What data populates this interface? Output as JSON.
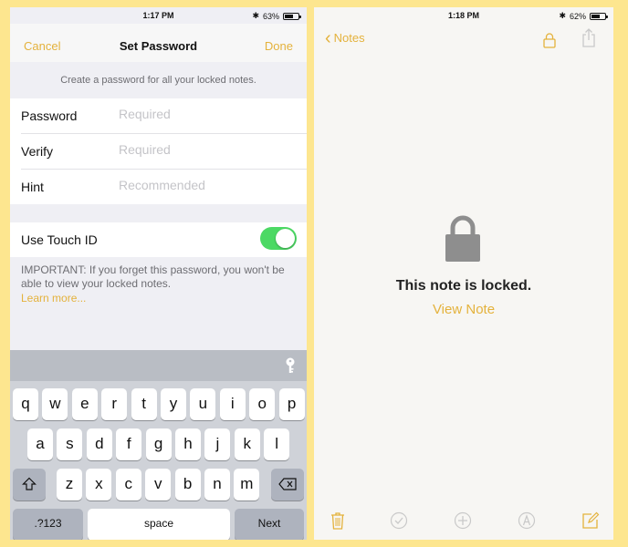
{
  "colors": {
    "accent": "#e4b23c",
    "toggle_on": "#4cd964",
    "background": "#fde68f"
  },
  "left_phone": {
    "status": {
      "time": "1:17 PM",
      "battery": "63%",
      "battery_fraction": 0.63
    },
    "nav": {
      "cancel": "Cancel",
      "title": "Set Password",
      "done": "Done"
    },
    "header_text": "Create a password for all your locked notes.",
    "fields": [
      {
        "label": "Password",
        "placeholder": "Required"
      },
      {
        "label": "Verify",
        "placeholder": "Required"
      },
      {
        "label": "Hint",
        "placeholder": "Recommended"
      }
    ],
    "touch_id": {
      "label": "Use Touch ID",
      "enabled": true
    },
    "important": "IMPORTANT: If you forget this password, you won't be able to view your locked notes.",
    "learn_more": "Learn more...",
    "keyboard": {
      "row1": [
        "q",
        "w",
        "e",
        "r",
        "t",
        "y",
        "u",
        "i",
        "o",
        "p"
      ],
      "row2": [
        "a",
        "s",
        "d",
        "f",
        "g",
        "h",
        "j",
        "k",
        "l"
      ],
      "row3": [
        "z",
        "x",
        "c",
        "v",
        "b",
        "n",
        "m"
      ],
      "numbers": ".?123",
      "space": "space",
      "next": "Next",
      "icons": {
        "shift": "shift-icon",
        "delete": "delete-icon",
        "accessory": "key-icon"
      }
    }
  },
  "right_phone": {
    "status": {
      "time": "1:18 PM",
      "battery": "62%",
      "battery_fraction": 0.62
    },
    "back_label": "Notes",
    "locked_text": "This note is locked.",
    "view_note": "View Note",
    "toolbar_icons": [
      "trash-icon",
      "checklist-icon",
      "add-icon",
      "sketch-icon",
      "compose-icon"
    ]
  }
}
